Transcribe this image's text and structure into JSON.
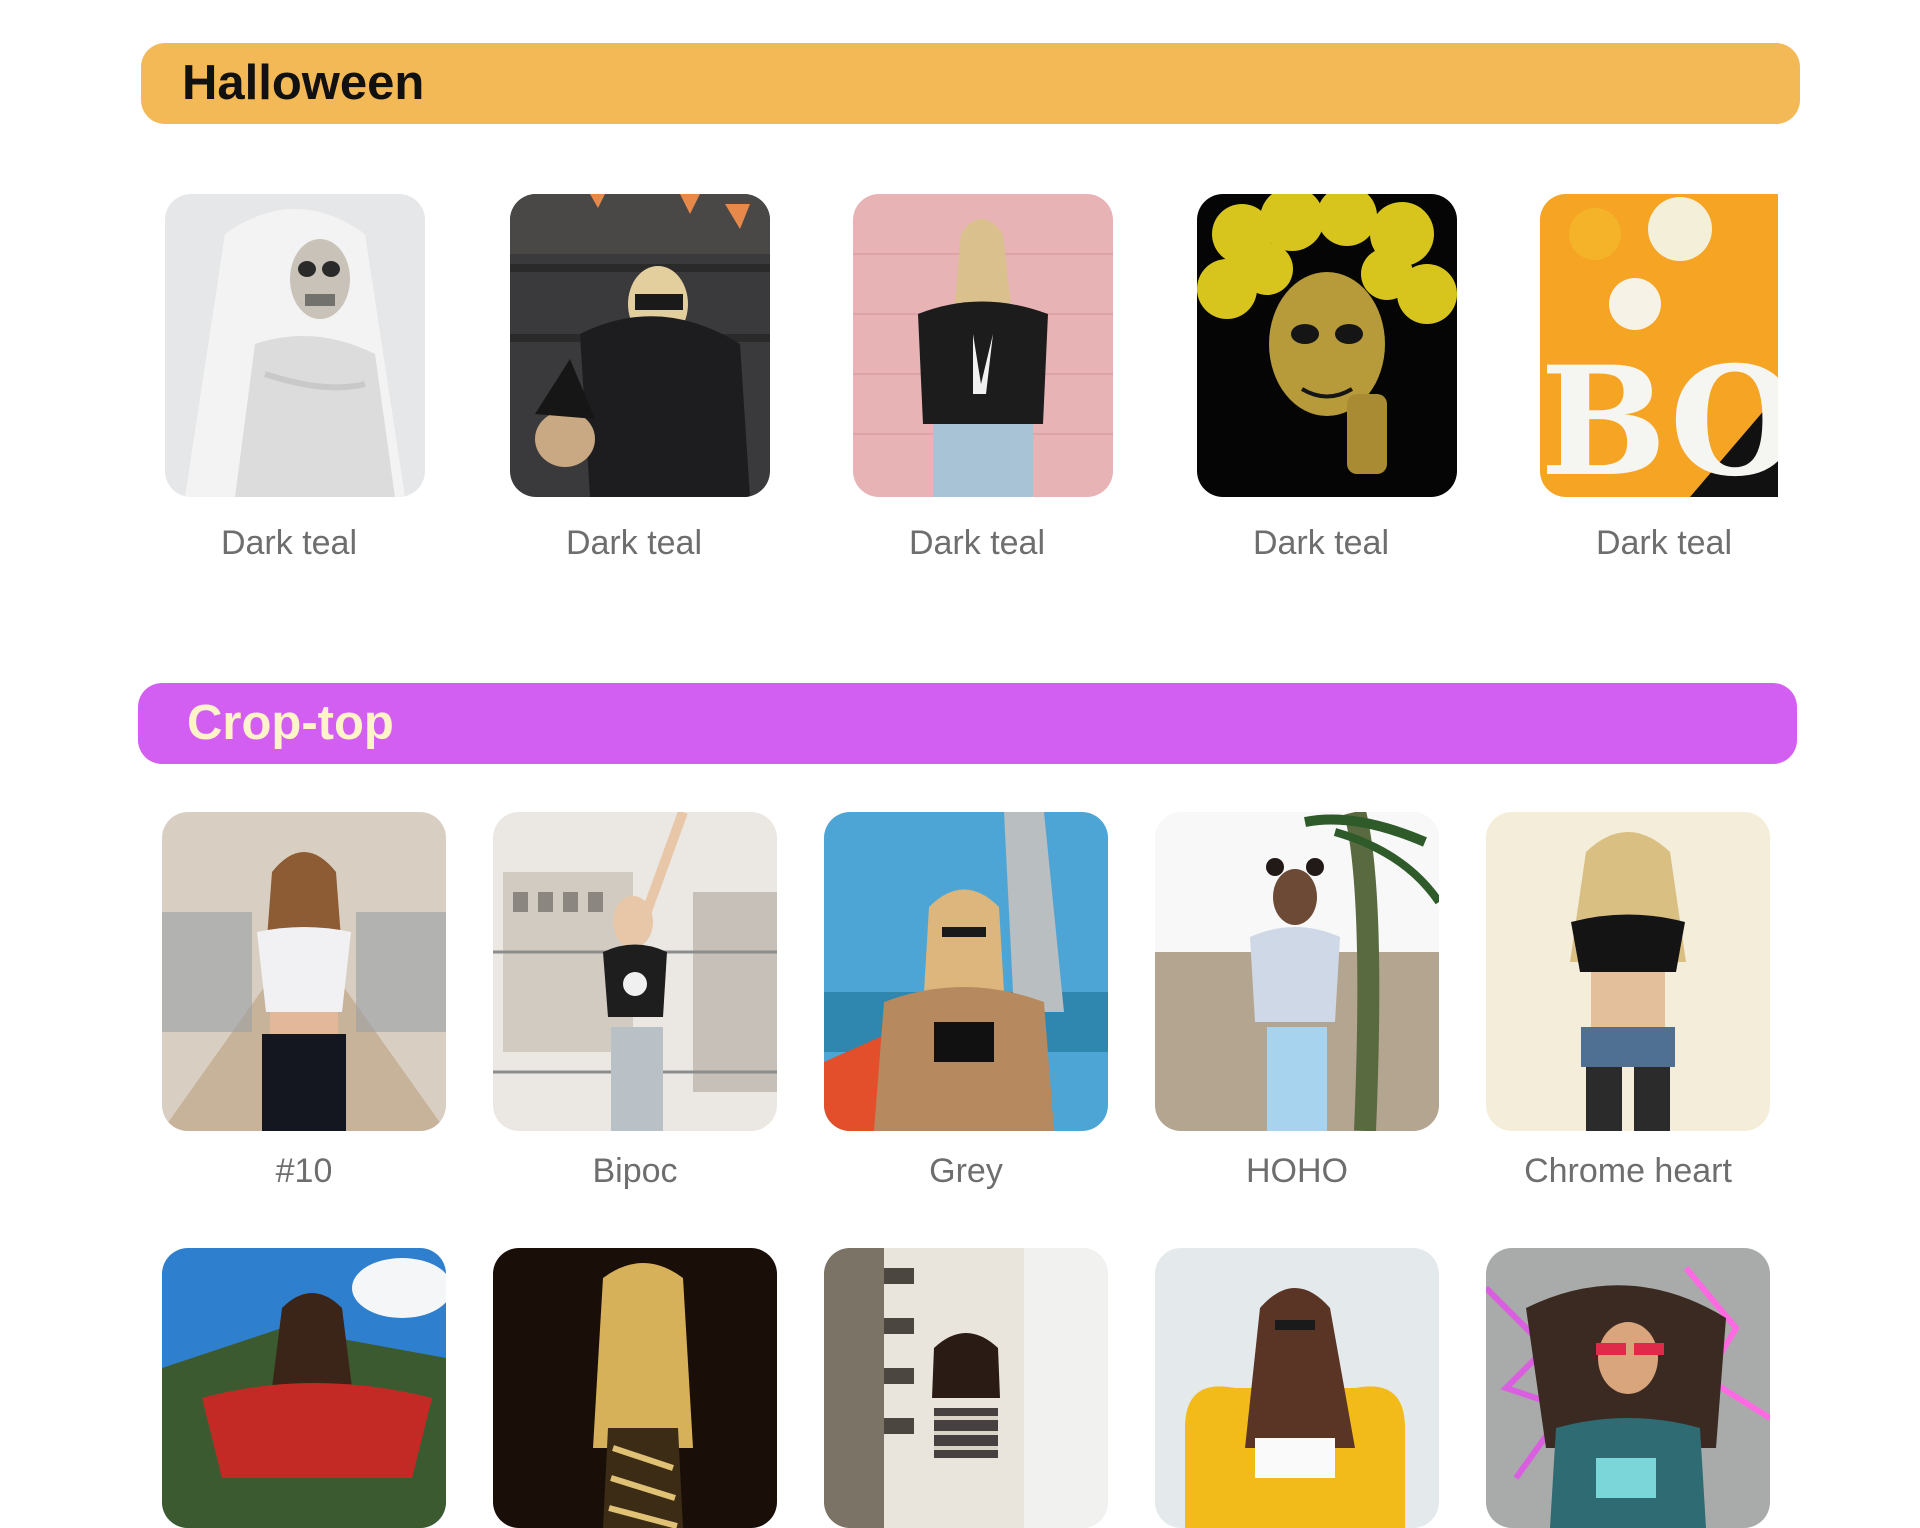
{
  "colors": {
    "halloween_header_bg": "#f3b957",
    "crop_header_bg": "#d35ff2",
    "label_text": "#6e6e6e"
  },
  "halloween": {
    "title": "Halloween",
    "items": [
      {
        "label": "Dark teal",
        "image": "skeleton-bride-veil"
      },
      {
        "label": "Dark teal",
        "image": "witch-mom-and-child"
      },
      {
        "label": "Dark teal",
        "image": "skeleton-peace-tee-pink-wall"
      },
      {
        "label": "Dark teal",
        "image": "sugar-skull-marigolds"
      },
      {
        "label": "Dark teal",
        "image": "boo-pumpkins"
      }
    ]
  },
  "crop_top": {
    "title": "Crop-top",
    "row1": [
      {
        "label": "#10",
        "image": "los-angeles-crop-top-bridge"
      },
      {
        "label": "Bipoc",
        "image": "skeleton-crop-rooftop"
      },
      {
        "label": "Grey",
        "image": "jacket-crop-sunglasses"
      },
      {
        "label": "HOHO",
        "image": "hoodie-crop-palm"
      },
      {
        "label": "Chrome heart",
        "image": "black-crop-fishnets"
      }
    ],
    "row2": [
      {
        "label": "",
        "image": "red-offshoulder-crop"
      },
      {
        "label": "",
        "image": "zebra-top-dark"
      },
      {
        "label": "",
        "image": "striped-crop-building"
      },
      {
        "label": "",
        "image": "white-crop-yellow-chair"
      },
      {
        "label": "",
        "image": "neon-tee-sunglasses"
      }
    ]
  }
}
